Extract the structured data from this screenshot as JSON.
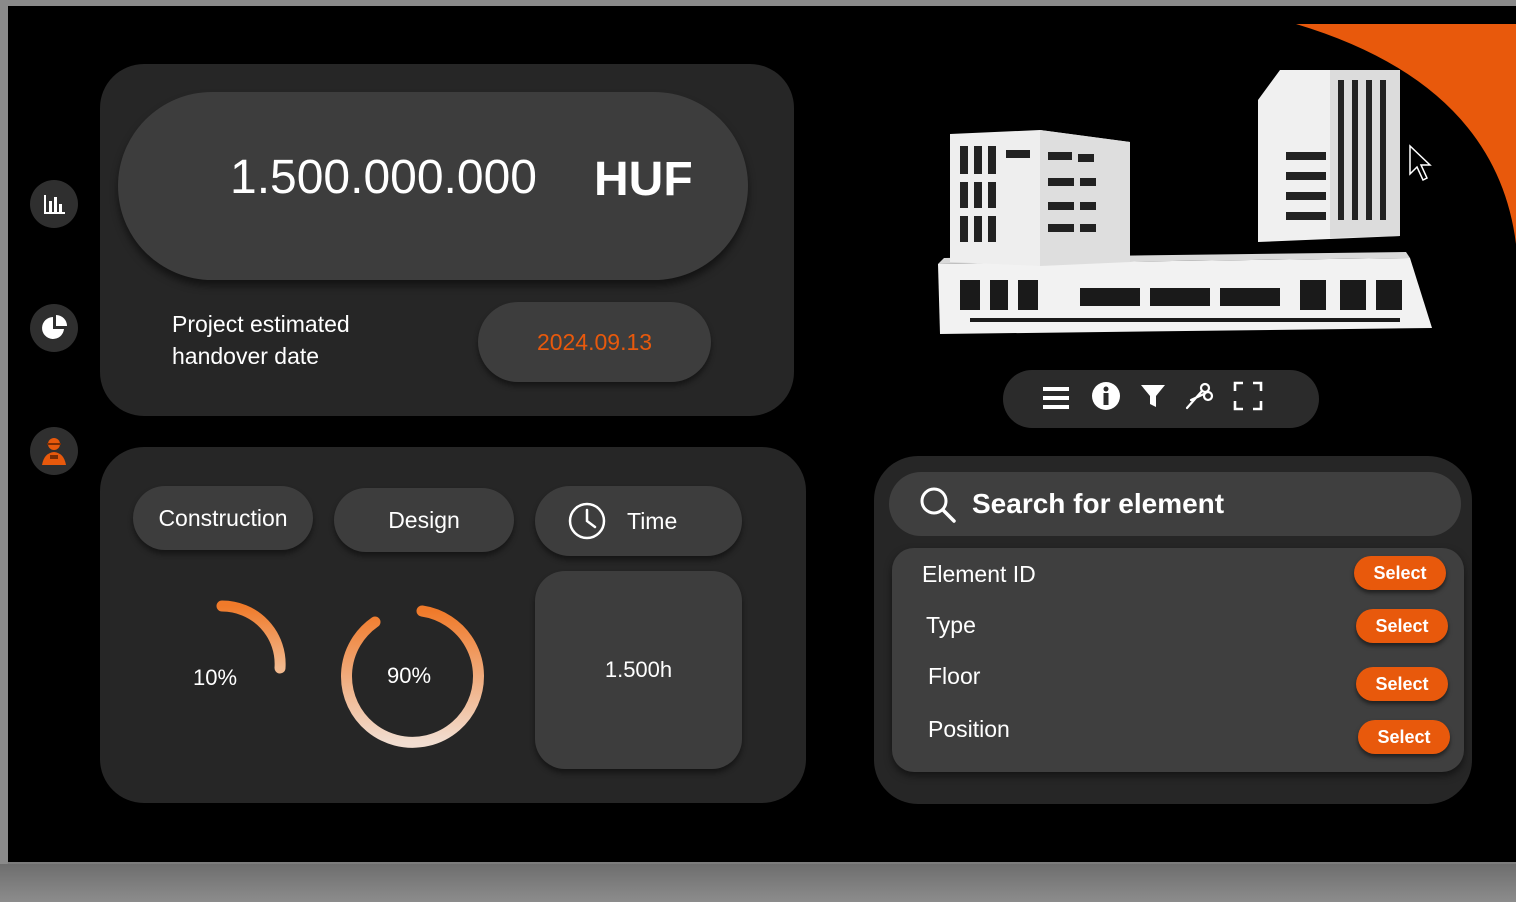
{
  "budget": {
    "amount": "1.500.000.000",
    "currency": "HUF"
  },
  "handover": {
    "label": "Project estimated handover date",
    "date": "2024.09.13"
  },
  "tabs": [
    {
      "label": "Construction"
    },
    {
      "label": "Design"
    },
    {
      "label": "Time"
    }
  ],
  "progress": {
    "construction": {
      "label": "10%",
      "value": 10
    },
    "design": {
      "label": "90%",
      "value": 90
    }
  },
  "time": {
    "value": "1.500h"
  },
  "sidebar": {
    "icons": [
      "bar-chart-icon",
      "pie-chart-icon",
      "worker-icon"
    ]
  },
  "toolbar": {
    "icons": [
      "menu-icon",
      "info-icon",
      "filter-icon",
      "section-cut-icon",
      "fullscreen-icon"
    ]
  },
  "search": {
    "placeholder": "Search for element"
  },
  "elements": [
    {
      "label": "Element ID",
      "button": "Select"
    },
    {
      "label": "Type",
      "button": "Select"
    },
    {
      "label": "Floor",
      "button": "Select"
    },
    {
      "label": "Position",
      "button": "Select"
    }
  ],
  "colors": {
    "accent": "#e8590c",
    "panel": "#262626",
    "pill": "#3d3d3d"
  }
}
